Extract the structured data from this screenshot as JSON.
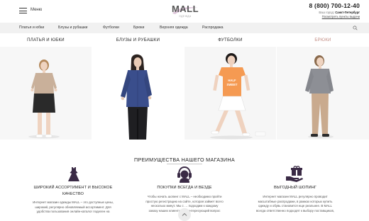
{
  "header": {
    "menu_label": "Меню",
    "logo_text": "MALL",
    "logo_subtext": "ОДЕЖДА",
    "phone": "8 (800) 700-12-40",
    "city_prefix": "Ваш город:",
    "city": "Санкт-Петербург",
    "pickup_link": "Посмотреть пункты выдачи"
  },
  "nav": {
    "items": [
      {
        "label": "Платья и юбки"
      },
      {
        "label": "Блузы и рубашки"
      },
      {
        "label": "Футболки"
      },
      {
        "label": "Брюки"
      },
      {
        "label": "Верхняя одежда"
      },
      {
        "label": "Распродажа"
      }
    ],
    "search_icon": "search-icon"
  },
  "categories": [
    {
      "title": "ПЛАТЬЯ И ЮБКИ"
    },
    {
      "title": "БЛУЗЫ И РУБАШКИ"
    },
    {
      "title": "ФУТБОЛКИ"
    },
    {
      "title": "БРЮКИ"
    }
  ],
  "advantages": {
    "title": "ПРЕИМУЩЕСТВА НАШЕГО МАГАЗИНА",
    "items": [
      {
        "icon": "dress-icon",
        "heading_line1": "ШИРОКИЙ АССОРТИМЕНТ И ВЫСОКОЕ",
        "heading_line2": "КАЧЕСТВО",
        "text_line1": "Интернет магазин одежды MALL – это доступные цены,",
        "text_line2": "широкий, регулярно обновляемый ассортимент. Для",
        "text_line3": "удобства пользования онлайн-каталог поделен на"
      },
      {
        "icon": "headset-operator-icon",
        "heading_line1": "ПОКУПКИ ВСЕГДА И ВЕЗДЕ",
        "text_line1": "Чтобы начать шопинг с MALL – необходимо пройти",
        "text_line2": "простую регистрацию на сайте, которая займет всего",
        "text_line3": "несколько минут. Мы с … подходим к каждому",
        "text_line4": "заказу наших клиентов. … интересующий вопрос"
      },
      {
        "icon": "gift-hand-icon",
        "heading_line1": "ВЫГОДНЫЙ ШОПИНГ",
        "text_line1": "Интернет магазин MALL регулярно проводит",
        "text_line2": "масштабные распродажи, в рамках которых купить",
        "text_line3": "одежду и обувь становится еще реальнее. В MALL",
        "text_line4": "всегда ответственно подходят к выбору поставщиков,"
      }
    ]
  },
  "colors": {
    "nav_bg": "#f1f1f1",
    "accent_purple": "#3a2a45",
    "logo_swoosh": "#c9a6c3",
    "footer_cat_title": "#c08a80"
  },
  "scroll_up_icon": "chevron-up-icon"
}
